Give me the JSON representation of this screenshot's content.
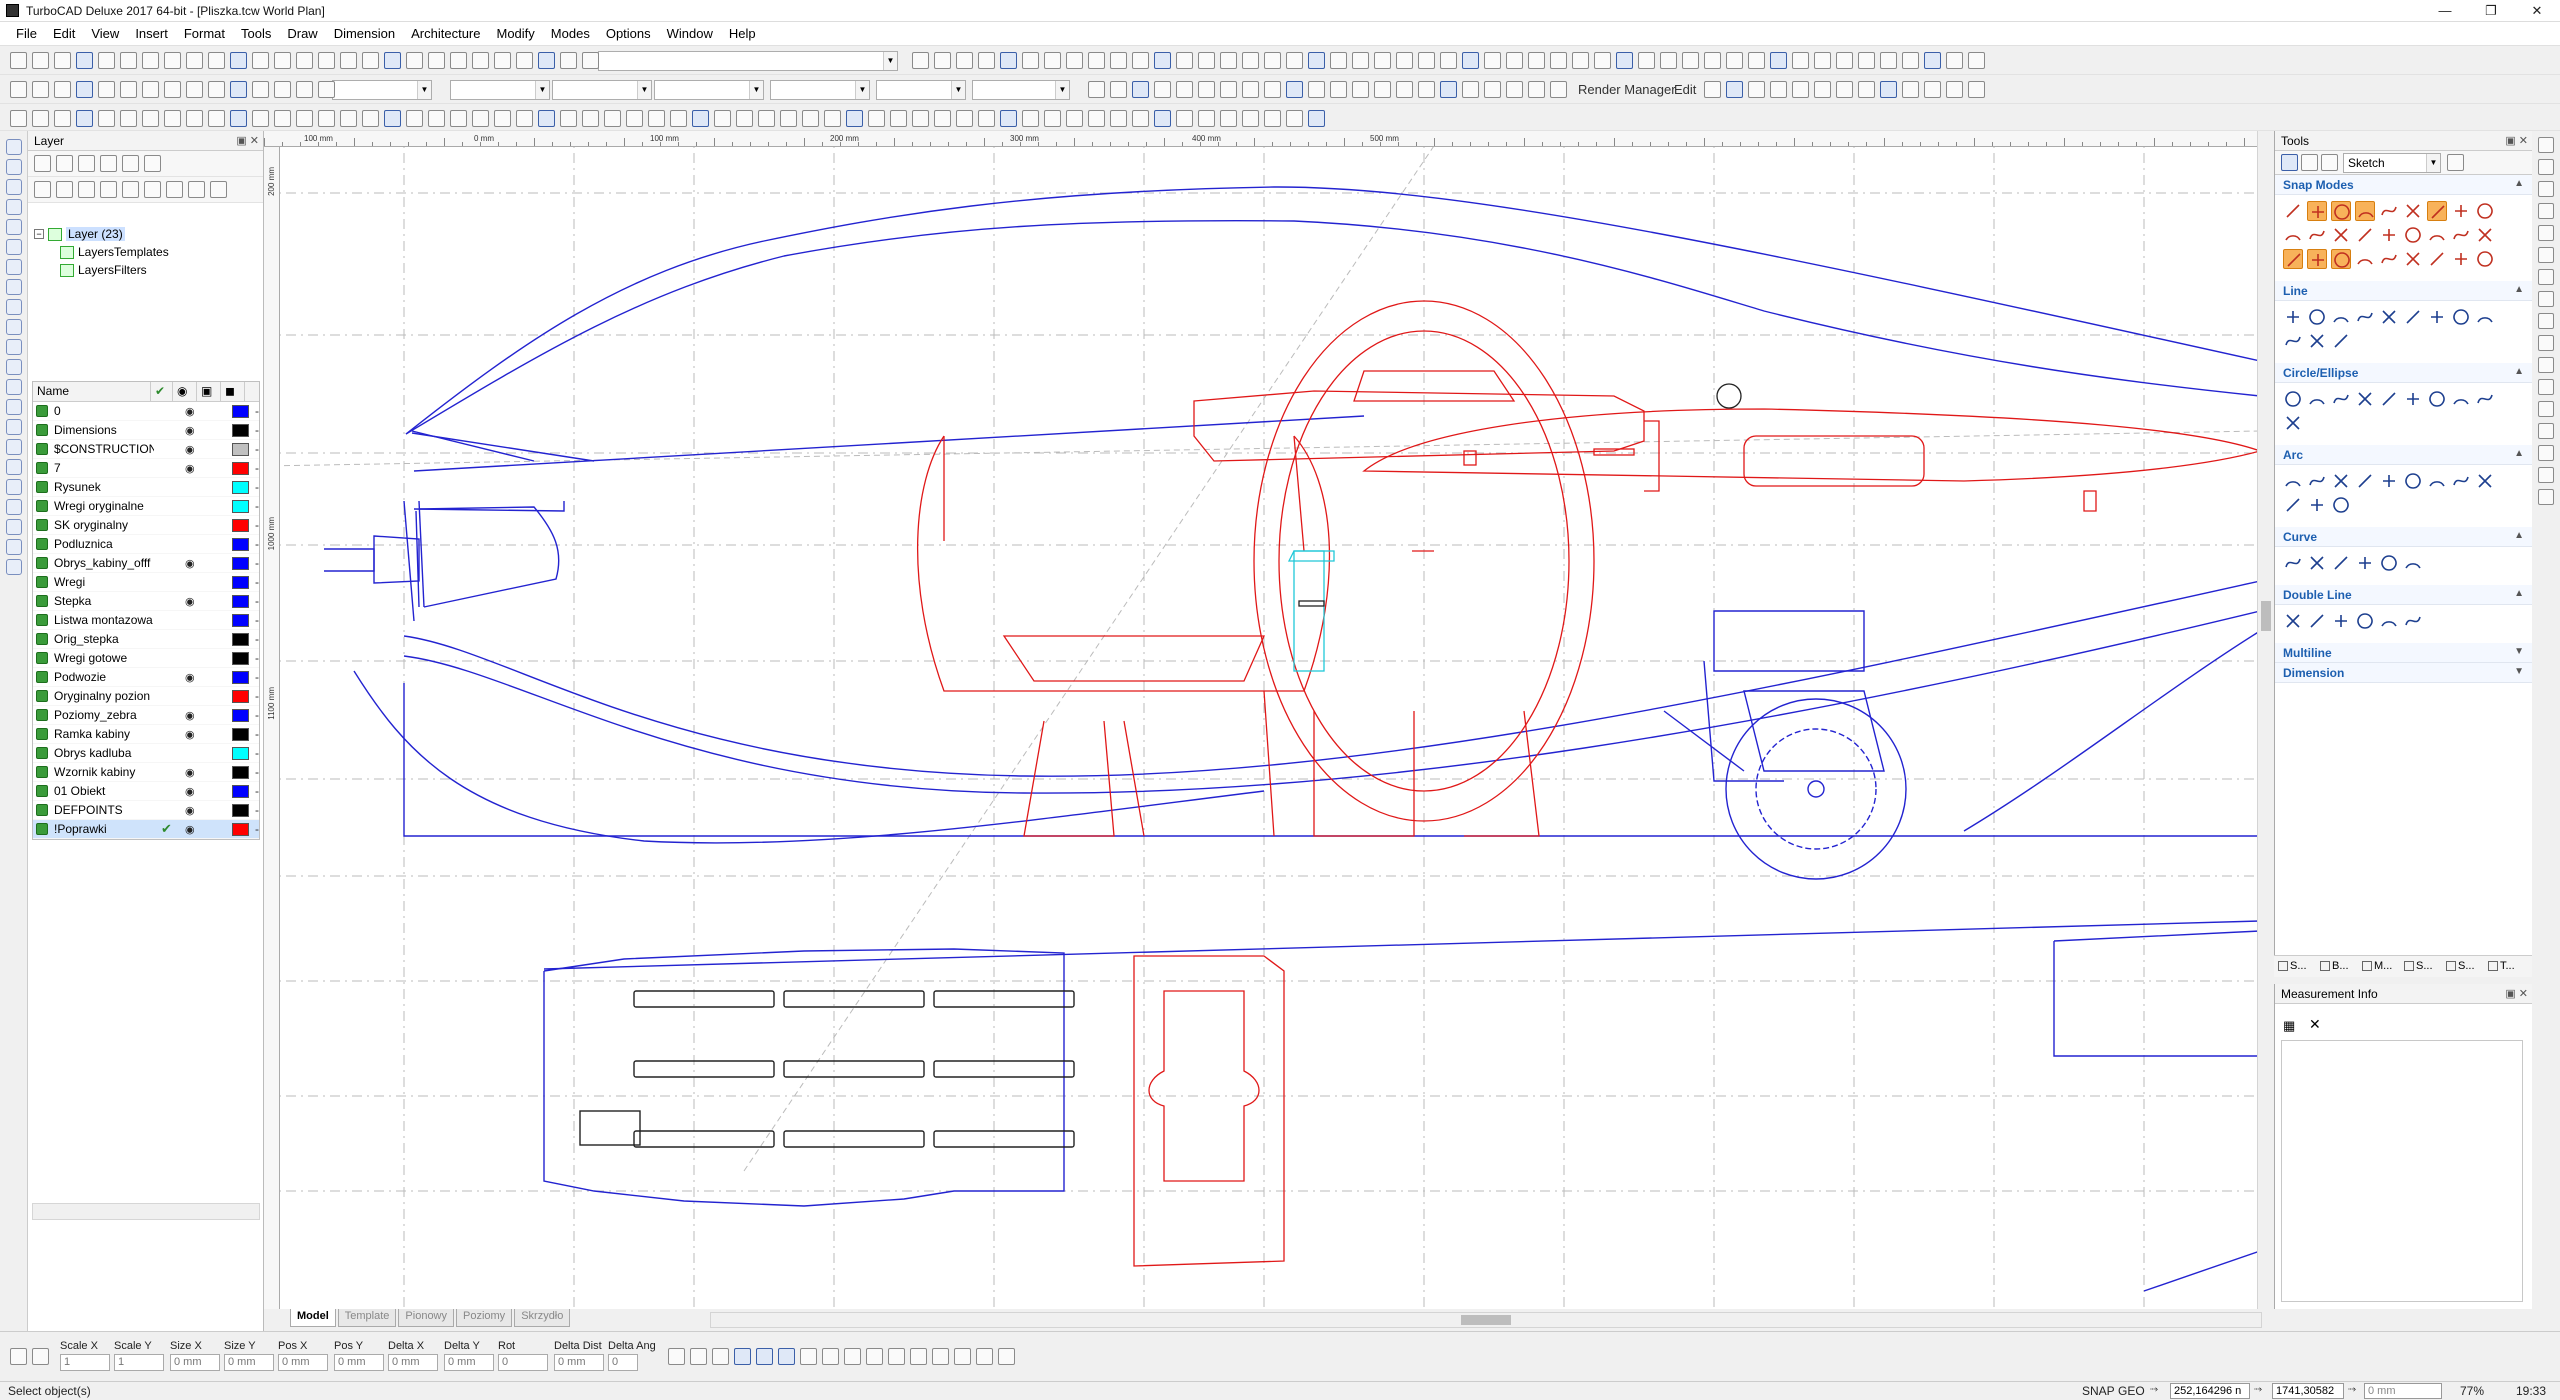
{
  "app": {
    "title": "TurboCAD Deluxe 2017 64-bit - [Pliszka.tcw World Plan]"
  },
  "menu": [
    "File",
    "Edit",
    "View",
    "Insert",
    "Format",
    "Tools",
    "Draw",
    "Dimension",
    "Architecture",
    "Modify",
    "Modes",
    "Options",
    "Window",
    "Help"
  ],
  "toolbar": {
    "render_manager": "Render Manager",
    "edit": "Edit"
  },
  "layer_panel": {
    "title": "Layer",
    "tree": {
      "root": "Layer (23)",
      "children": [
        "LayersTemplates",
        "LayersFilters"
      ]
    },
    "columns": {
      "name": "Name"
    },
    "layers": [
      {
        "name": "0",
        "visible": true,
        "color": "#0000ff",
        "selected": false
      },
      {
        "name": "Dimensions",
        "visible": true,
        "color": "#000000",
        "selected": false
      },
      {
        "name": "$CONSTRUCTION",
        "visible": true,
        "color": "#c0c0c0",
        "selected": false
      },
      {
        "name": "7",
        "visible": true,
        "color": "#ff0000",
        "selected": false
      },
      {
        "name": "Rysunek",
        "visible": false,
        "color": "#00ffff",
        "selected": false
      },
      {
        "name": "Wregi oryginalne",
        "visible": false,
        "color": "#00ffff",
        "selected": false
      },
      {
        "name": "SK oryginalny",
        "visible": false,
        "color": "#ff0000",
        "selected": false
      },
      {
        "name": "Podluznica",
        "visible": false,
        "color": "#0000ff",
        "selected": false
      },
      {
        "name": "Obrys_kabiny_offf",
        "visible": true,
        "color": "#0000ff",
        "selected": false
      },
      {
        "name": "Wregi",
        "visible": false,
        "color": "#0000ff",
        "selected": false
      },
      {
        "name": "Stepka",
        "visible": true,
        "color": "#0000ff",
        "selected": false
      },
      {
        "name": "Listwa montazowa",
        "visible": false,
        "color": "#0000ff",
        "selected": false
      },
      {
        "name": "Orig_stepka",
        "visible": false,
        "color": "#000000",
        "selected": false
      },
      {
        "name": "Wregi gotowe",
        "visible": false,
        "color": "#000000",
        "selected": false
      },
      {
        "name": "Podwozie",
        "visible": true,
        "color": "#0000ff",
        "selected": false
      },
      {
        "name": "Oryginalny pozion",
        "visible": false,
        "color": "#ff0000",
        "selected": false
      },
      {
        "name": "Poziomy_zebra",
        "visible": true,
        "color": "#0000ff",
        "selected": false
      },
      {
        "name": "Ramka kabiny",
        "visible": true,
        "color": "#000000",
        "selected": false
      },
      {
        "name": "Obrys kadluba",
        "visible": false,
        "color": "#00ffff",
        "selected": false
      },
      {
        "name": "Wzornik kabiny",
        "visible": true,
        "color": "#000000",
        "selected": false
      },
      {
        "name": "01 Obiekt",
        "visible": true,
        "color": "#0000ff",
        "selected": false
      },
      {
        "name": "DEFPOINTS",
        "visible": true,
        "color": "#000000",
        "selected": false
      },
      {
        "name": "!Poprawki",
        "visible": true,
        "color": "#ff0000",
        "selected": true
      }
    ]
  },
  "ruler": {
    "h_labels": [
      "100 mm",
      "0 mm",
      "100 mm",
      "200 mm",
      "300 mm",
      "400 mm",
      "500 mm"
    ],
    "v_labels": [
      "200 mm",
      "1000 mm",
      "1100 mm"
    ]
  },
  "canvas_tabs": [
    "Model",
    "Template",
    "Pionowy",
    "Poziomy",
    "Skrzydło"
  ],
  "tools_panel": {
    "title": "Tools",
    "mode": "Sketch",
    "sections": [
      "Snap Modes",
      "Line",
      "Circle/Ellipse",
      "Arc",
      "Curve",
      "Double Line",
      "Multiline",
      "Dimension"
    ],
    "tabs": [
      "S...",
      "B...",
      "M...",
      "S...",
      "S...",
      "T..."
    ]
  },
  "measurement": {
    "title": "Measurement Info"
  },
  "inspector": {
    "fields": [
      "Scale X",
      "Scale Y",
      "Size X",
      "Size Y",
      "Pos X",
      "Pos Y",
      "Delta X",
      "Delta Y",
      "Rot",
      "Delta Dist",
      "Delta Ang"
    ],
    "values": [
      "1",
      "1",
      "0 mm",
      "0 mm",
      "0 mm",
      "0 mm",
      "0 mm",
      "0 mm",
      "0",
      "0 mm",
      "0"
    ]
  },
  "status": {
    "message": "Select object(s)",
    "snap": "SNAP",
    "geo": "GEO",
    "coord_x": "252,164296 n",
    "coord_y": "1741,30582 n",
    "coord_z": "0 mm",
    "zoom": "77%",
    "time": "19:33"
  }
}
